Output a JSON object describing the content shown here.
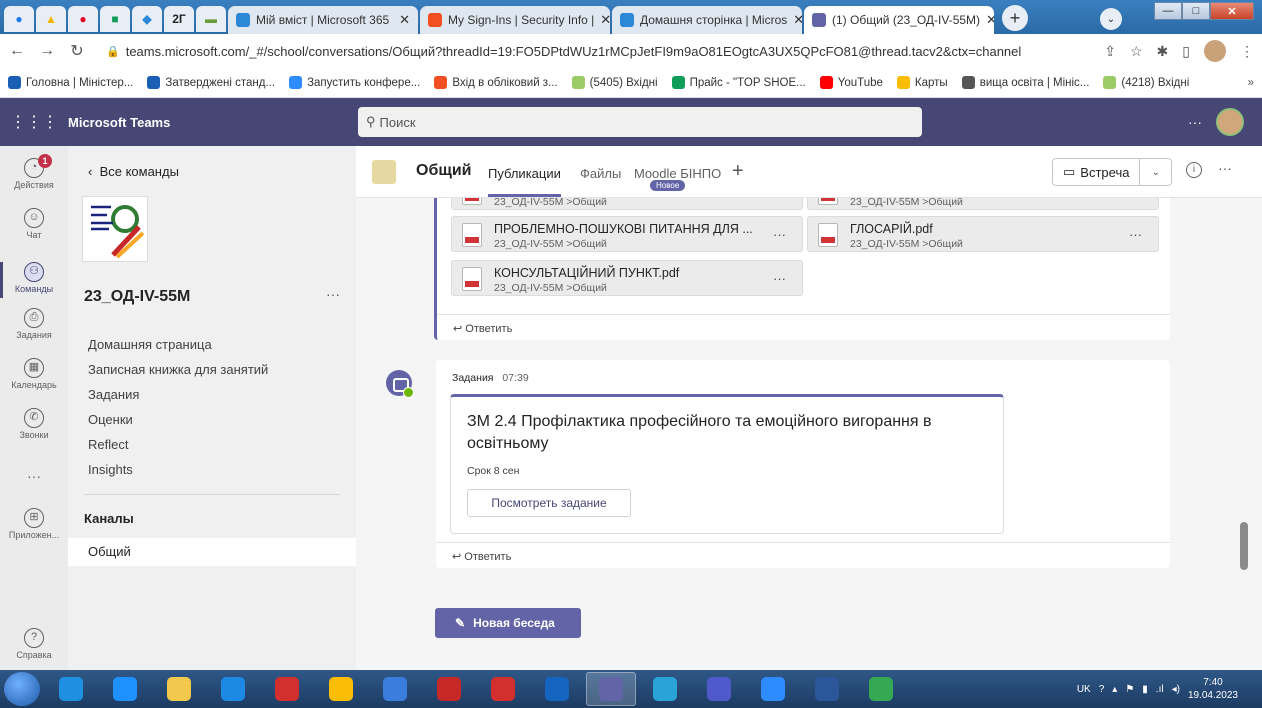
{
  "browser": {
    "pinned_tabs": [
      "2Г"
    ],
    "tabs": [
      {
        "label": "Мій вміст | Microsoft 365",
        "color": "#2b88d8"
      },
      {
        "label": "My Sign-Ins | Security Info | ",
        "color": "#f25022"
      },
      {
        "label": "Домашня сторінка | Micros",
        "color": "#2b88d8"
      },
      {
        "label": "(1) Общий (23_ОД-IV-55M)",
        "color": "#6264a7",
        "active": true
      }
    ],
    "url": "teams.microsoft.com/_#/school/conversations/Общий?threadId=19:FO5DPtdWUz1rMCpJetFI9m9aO81EOgtcA3UX5QPcFO81@thread.tacv2&ctx=channel",
    "bookmarks": [
      {
        "label": "Головна | Міністер...",
        "color": "#1a5fb4"
      },
      {
        "label": "Затверджені станд...",
        "color": "#1a5fb4"
      },
      {
        "label": "Запустить конфере...",
        "color": "#2d8cff"
      },
      {
        "label": "Вхід в обліковий з...",
        "color": "#f25022"
      },
      {
        "label": "(5405) Вхідні",
        "color": "#9ccc65"
      },
      {
        "label": "Прайс - \"TOP SHOE...",
        "color": "#0f9d58"
      },
      {
        "label": "YouTube",
        "color": "#ff0000"
      },
      {
        "label": "Карты",
        "color": "#fbbc04"
      },
      {
        "label": "вища освіта | Мініс...",
        "color": "#555555"
      },
      {
        "label": "(4218) Вхідні",
        "color": "#9ccc65"
      }
    ],
    "bookmarks_more": "»"
  },
  "teams": {
    "app_name": "Microsoft Teams",
    "search_placeholder": "Поиск",
    "more": "···"
  },
  "appbar": [
    {
      "label": "Действия",
      "icon": "bell-icon",
      "badge": "1"
    },
    {
      "label": "Чат",
      "icon": "chat-icon"
    },
    {
      "label": "Команды",
      "icon": "teams-icon",
      "active": true
    },
    {
      "label": "Задания",
      "icon": "assignments-icon"
    },
    {
      "label": "Календарь",
      "icon": "calendar-icon"
    },
    {
      "label": "Звонки",
      "icon": "phone-icon"
    },
    {
      "label": "",
      "icon": "more-icon"
    },
    {
      "label": "Приложен...",
      "icon": "apps-icon"
    },
    {
      "label": "Справка",
      "icon": "help-icon"
    }
  ],
  "leftpanel": {
    "back_label": "Все команды",
    "team_name": "23_ОД-IV-55М",
    "team_more": "···",
    "nav": [
      "Домашняя страница",
      "Записная книжка для занятий",
      "Задания",
      "Оценки",
      "Reflect",
      "Insights"
    ],
    "channels_header": "Каналы",
    "channel": "Общий"
  },
  "channel_header": {
    "title": "Общий",
    "tabs": [
      "Публикации",
      "Файлы",
      "Moodle БІНПО"
    ],
    "new_badge": "Новое",
    "meet_label": "Встреча"
  },
  "post1": {
    "attachments": [
      {
        "name": "ПРОБЛЕМНО-ПОШУКОВІ ПИТАННЯ ДЛЯ ...",
        "path": "23_ОД-IV-55M >Общий"
      },
      {
        "name": "ГЛОСАРІЙ.pdf",
        "path": "23_ОД-IV-55M >Общий"
      },
      {
        "name": "КОНСУЛЬТАЦІЙНИЙ ПУНКТ.pdf",
        "path": "23_ОД-IV-55M >Общий"
      }
    ],
    "partial_path": "23_ОД-IV-55M >Общий",
    "reply": "Ответить"
  },
  "post2": {
    "author": "Задания",
    "time": "07:39",
    "assignment_title": "ЗМ 2.4 Профілактика професійного та емоційного вигорання в освітньому",
    "due": "Срок 8 сен",
    "view_button": "Посмотреть задание",
    "reply": "Ответить"
  },
  "new_conversation": "Новая беседа",
  "taskbar": {
    "apps": [
      "#1e8fe1",
      "#1e90ff",
      "#f2c94c",
      "#1e88e5",
      "#d32f2f",
      "#fbbc04",
      "#3b7ddd",
      "#c62828",
      "#d32f2f",
      "#1565c0",
      "#6264a7",
      "#2aa3d8",
      "#5059c9",
      "#2d8cff",
      "#2b579a",
      "#34a853"
    ],
    "active_index": 10,
    "tray_lang": "UK",
    "time": "7:40",
    "date": "19.04.2023"
  }
}
